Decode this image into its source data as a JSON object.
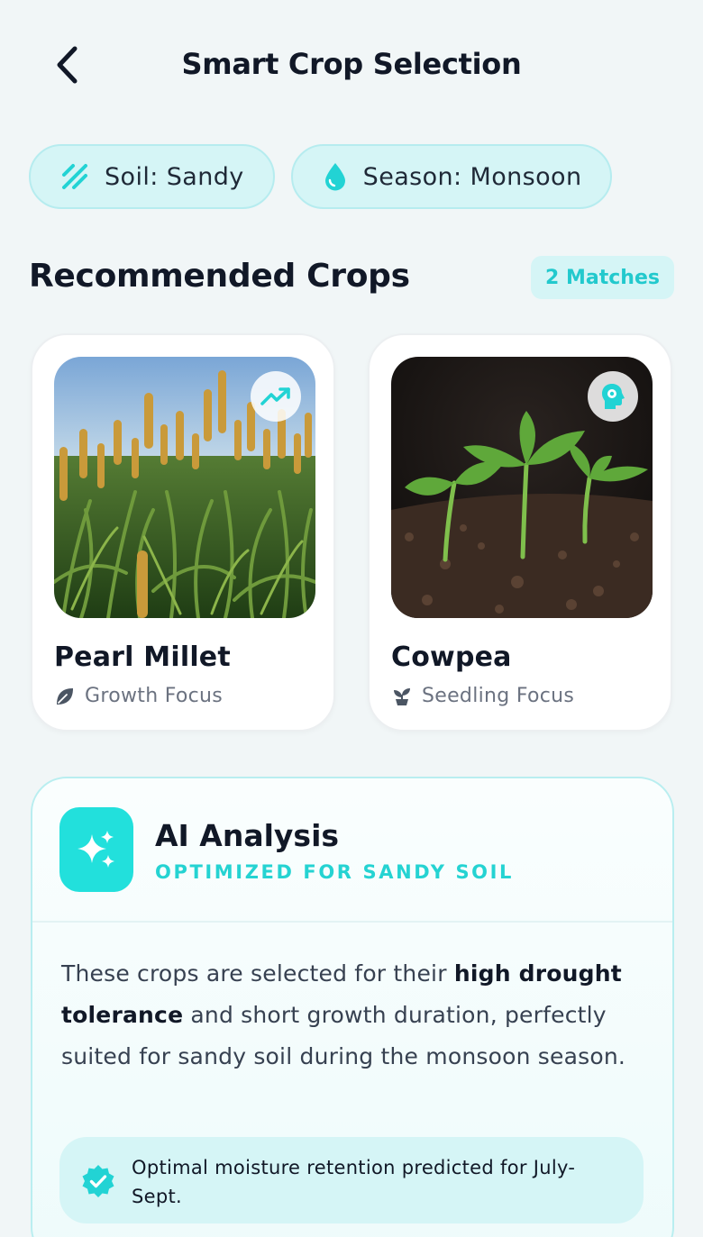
{
  "header": {
    "title": "Smart Crop Selection"
  },
  "filters": [
    {
      "label": "Soil: Sandy",
      "icon": "soil-hatch-icon"
    },
    {
      "label": "Season: Monsoon",
      "icon": "water-drop-icon"
    }
  ],
  "recommended": {
    "title": "Recommended Crops",
    "badge": "2 Matches",
    "crops": [
      {
        "name": "Pearl Millet",
        "focus": "Growth Focus",
        "focus_icon": "leaf-icon",
        "badge_icon": "trending-up-icon"
      },
      {
        "name": "Cowpea",
        "focus": "Seedling Focus",
        "focus_icon": "sprout-icon",
        "badge_icon": "head-gear-icon"
      }
    ]
  },
  "ai": {
    "title": "AI Analysis",
    "subtitle": "OPTIMIZED FOR SANDY SOIL",
    "body_pre": "These crops are selected for their ",
    "body_bold": "high drought tolerance",
    "body_post": " and short growth duration, perfectly suited for sandy soil during the monsoon season.",
    "note": "Optimal moisture retention predicted for July-Sept."
  },
  "colors": {
    "accent": "#22e0dc",
    "chip_bg": "#d5f5f6",
    "background": "#f1f6f7"
  }
}
